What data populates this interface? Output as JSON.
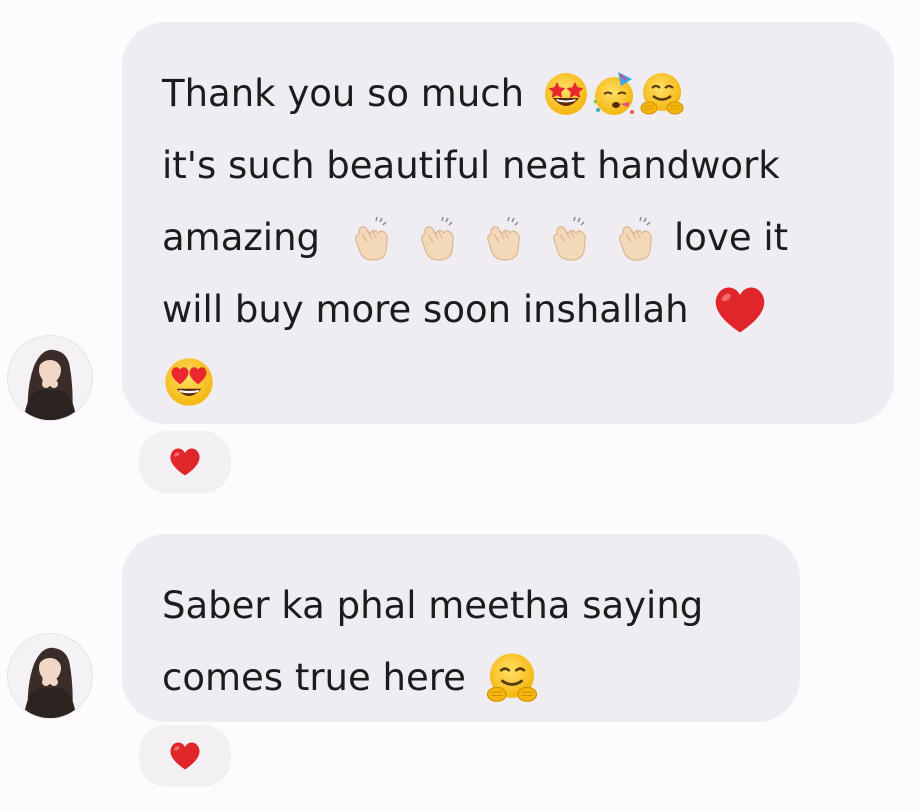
{
  "messages": [
    {
      "lines": [
        {
          "text": "Thank you so much",
          "emoji": [
            "star-struck-emoji",
            "partying-face-emoji",
            "hugging-face-emoji"
          ]
        },
        {
          "text": "it's such beautiful neat handwork"
        },
        {
          "text": "amazing",
          "emoji": [
            "clapping-hands-emoji",
            "clapping-hands-emoji",
            "clapping-hands-emoji",
            "clapping-hands-emoji",
            "clapping-hands-emoji"
          ],
          "trailing_text": "love it"
        },
        {
          "text": "will buy more soon inshallah",
          "emoji": [
            "red-heart-emoji"
          ]
        },
        {
          "text": "",
          "emoji": [
            "heart-eyes-emoji"
          ]
        }
      ],
      "reaction": "red-heart-icon"
    },
    {
      "lines": [
        {
          "text": "Saber ka phal meetha saying"
        },
        {
          "text": "comes true here",
          "emoji": [
            "hugging-face-emoji"
          ]
        }
      ],
      "reaction": "red-heart-icon"
    }
  ],
  "colors": {
    "background": "#fdfbfd",
    "bubble": "#efecf2",
    "text": "#1e1b1f",
    "heart": "#e0262b"
  }
}
